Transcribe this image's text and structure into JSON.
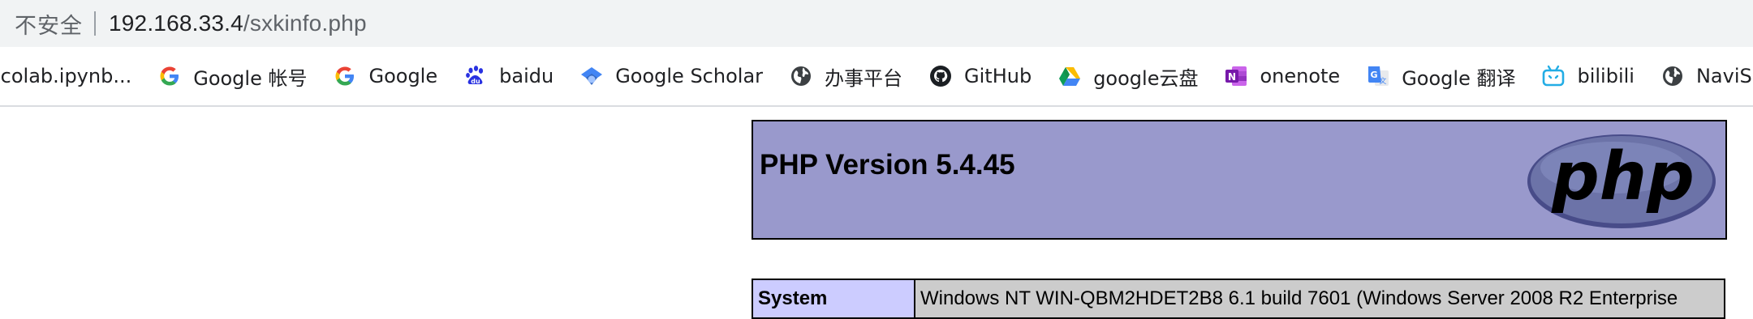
{
  "address_bar": {
    "security_label": "不安全",
    "url_host": "192.168.33.4",
    "url_path": "/sxkinfo.php"
  },
  "bookmarks": [
    {
      "label": "-colab.ipynb...",
      "icon": "none"
    },
    {
      "label": "Google 帐号",
      "icon": "google-icon"
    },
    {
      "label": "Google",
      "icon": "google-icon"
    },
    {
      "label": "baidu",
      "icon": "baidu-paw-icon"
    },
    {
      "label": "Google Scholar",
      "icon": "scholar-cap-icon"
    },
    {
      "label": "办事平台",
      "icon": "globe-icon"
    },
    {
      "label": "GitHub",
      "icon": "github-icon"
    },
    {
      "label": "google云盘",
      "icon": "google-drive-icon"
    },
    {
      "label": "onenote",
      "icon": "onenote-icon"
    },
    {
      "label": "Google 翻译",
      "icon": "google-translate-icon"
    },
    {
      "label": "bilibili",
      "icon": "bilibili-tv-icon"
    },
    {
      "label": "NaviSe",
      "icon": "globe-icon"
    }
  ],
  "phpinfo": {
    "title": "PHP Version 5.4.45",
    "logo_text": "php",
    "rows": [
      {
        "key": "System",
        "value": "Windows NT WIN-QBM2HDET2B8 6.1 build 7601 (Windows Server 2008 R2 Enterprise"
      }
    ]
  },
  "colors": {
    "header_bg": "#9999cc",
    "key_bg": "#ccccff",
    "value_bg": "#cccccc",
    "logo_fill": "#6c73a8"
  }
}
